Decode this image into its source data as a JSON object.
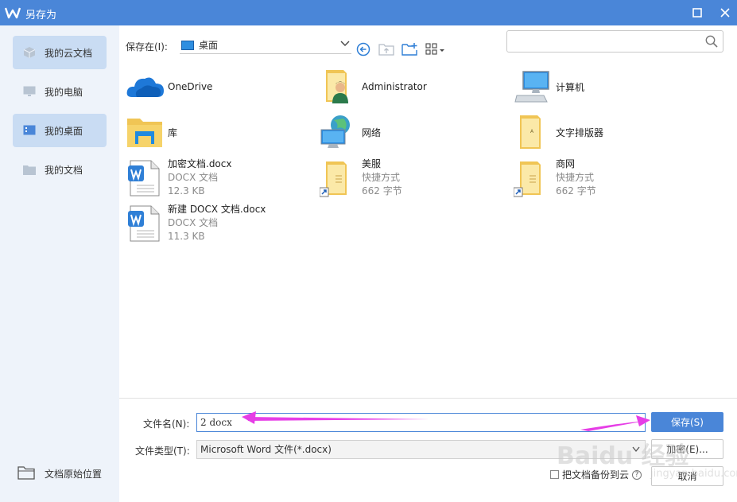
{
  "window": {
    "title": "另存为"
  },
  "sidebar": {
    "items": [
      {
        "label": "我的云文档",
        "icon": "cloud-cube-icon",
        "active": true
      },
      {
        "label": "我的电脑",
        "icon": "monitor-icon",
        "active": false
      },
      {
        "label": "我的桌面",
        "icon": "desktop-icon",
        "active": true
      },
      {
        "label": "我的文档",
        "icon": "folder-icon",
        "active": false
      }
    ],
    "bottom_label": "文档原始位置"
  },
  "toolbar": {
    "location_label": "保存在(I):",
    "location_value": "桌面"
  },
  "search": {
    "placeholder": ""
  },
  "files": [
    {
      "name": "OneDrive",
      "icon": "onedrive-cloud-icon"
    },
    {
      "name": "Administrator",
      "icon": "user-folder-icon"
    },
    {
      "name": "计算机",
      "icon": "computer-icon"
    },
    {
      "name": "库",
      "icon": "library-folder-icon"
    },
    {
      "name": "网络",
      "icon": "network-globe-icon"
    },
    {
      "name": "文字排版器",
      "icon": "folder-icon"
    },
    {
      "name": "加密文档.docx",
      "type": "DOCX 文档",
      "size": "12.3 KB",
      "icon": "word-doc-icon"
    },
    {
      "name": "美服",
      "type": "快捷方式",
      "size": "662 字节",
      "icon": "shortcut-folder-icon"
    },
    {
      "name": "商网",
      "type": "快捷方式",
      "size": "662 字节",
      "icon": "shortcut-folder-icon"
    },
    {
      "name": "新建 DOCX 文档.docx",
      "type": "DOCX 文档",
      "size": "11.3 KB",
      "icon": "word-doc-icon"
    }
  ],
  "form": {
    "filename_label": "文件名(N):",
    "filename_value": "2 docx",
    "filetype_label": "文件类型(T):",
    "filetype_value": "Microsoft Word 文件(*.docx)",
    "save_button": "保存(S)",
    "encrypt_button": "加密(E)...",
    "cancel_button": "取消",
    "backup_label": "把文档备份到云",
    "help_glyph": "?"
  },
  "overlay": {
    "watermark": "Baidu 经验",
    "watermark_sub": "jingyan.baidu.com",
    "arrow_color": "#e63ee6"
  },
  "colors": {
    "accent": "#4a86d8",
    "sidebar_bg": "#eef3fa",
    "sidebar_active": "#c9dcf3"
  }
}
